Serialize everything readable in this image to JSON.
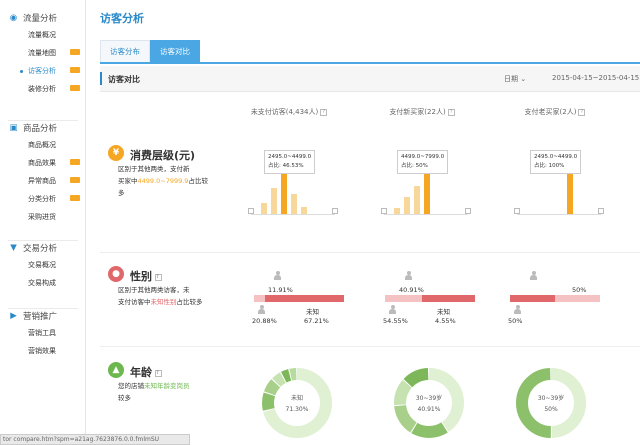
{
  "sidebar": {
    "sections": [
      {
        "title": "流量分析",
        "icon": "eye-icon",
        "items": [
          {
            "label": "流量概况"
          },
          {
            "label": "流量地图",
            "new": true
          },
          {
            "label": "访客分析",
            "new": true,
            "active": true
          },
          {
            "label": "装修分析",
            "new": true
          }
        ]
      },
      {
        "title": "商品分析",
        "icon": "shopping-bag-icon",
        "items": [
          {
            "label": "商品概况"
          },
          {
            "label": "商品效果",
            "new": true
          },
          {
            "label": "异常商品",
            "new": true
          },
          {
            "label": "分类分析",
            "new": true
          },
          {
            "label": "采购进货"
          }
        ]
      },
      {
        "title": "交易分析",
        "icon": "cart-icon",
        "items": [
          {
            "label": "交易概况"
          },
          {
            "label": "交易构成"
          }
        ]
      },
      {
        "title": "营销推广",
        "icon": "megaphone-icon",
        "items": [
          {
            "label": "营销工具"
          },
          {
            "label": "营销效果"
          }
        ]
      }
    ]
  },
  "page": {
    "title": "访客分析"
  },
  "tabs": [
    {
      "label": "访客分布"
    },
    {
      "label": "访客对比",
      "active": true
    }
  ],
  "bar": {
    "title": "访客对比",
    "date_label": "日期",
    "date_range": "2015-04-15~2015-04-15"
  },
  "columns": [
    {
      "label": "未支付访客(4,434人)"
    },
    {
      "label": "支付新买家(22人)"
    },
    {
      "label": "支付老买家(2人)"
    }
  ],
  "rows": {
    "consumption": {
      "title": "消费层级(元)",
      "desc_a": "区别于其他两类，支付新",
      "desc_b": "买家中",
      "desc_hl": "4499.0~7999.9",
      "desc_c": "占比较多",
      "icon": "yen-icon"
    },
    "gender": {
      "title": "性别",
      "desc_a": "区别于其他两类访客，未",
      "desc_b": "支付访客中",
      "desc_hl": "未知性别",
      "desc_c": "占比较多",
      "icon": "person-icon"
    },
    "age": {
      "title": "年龄",
      "desc_a": "您的店铺",
      "desc_hl": "未知年龄变岗员",
      "desc_c": "较多",
      "icon": "bar-chart-icon"
    }
  },
  "consumption_tips": [
    {
      "range": "2495.0~4499.0",
      "ratio": "占比: 46.53%"
    },
    {
      "range": "4499.0~7999.0",
      "ratio": "占比: 50%"
    },
    {
      "range": "2495.0~4499.0",
      "ratio": "占比: 100%"
    }
  ],
  "gender": [
    {
      "male": "11.91%",
      "female": "20.88%",
      "unknown_label": "未知",
      "unknown": "67.21%"
    },
    {
      "male": "40.91%",
      "female": "54.55%",
      "unknown_label": "未知",
      "unknown": "4.55%"
    },
    {
      "male": "50%",
      "female": "50%"
    }
  ],
  "age": [
    {
      "label": "未知",
      "value": "71.30%"
    },
    {
      "label": "30~39岁",
      "value": "40.91%"
    },
    {
      "label": "30~39岁",
      "value": "50%"
    }
  ],
  "status_text": "tor compare.htm?spm=a21ag.7623876.0.0.fmlmSU",
  "chart_data": [
    {
      "type": "bar",
      "title": "未支付访客(4,434人) 消费层级",
      "values": [
        0.09,
        0.22,
        0.47,
        0.17,
        0.06
      ],
      "highlight_index": 2
    },
    {
      "type": "bar",
      "title": "支付新买家(22人) 消费层级",
      "values": [
        0.05,
        0.14,
        0.23,
        0.5
      ],
      "highlight_index": 3
    },
    {
      "type": "bar",
      "title": "支付老买家(2人) 消费层级",
      "values": [
        1.0
      ],
      "highlight_index": 0
    }
  ],
  "colors": {
    "accent": "#2a8ac9",
    "tab_active": "#4aa7e4",
    "orange": "#f5a623",
    "orange_light": "#f8d79a",
    "red": "#e0686b",
    "pink": "#f5c2c4",
    "green": "#8cc06b",
    "green_light": "#dff0d3",
    "green_icon": "#6db84e"
  }
}
